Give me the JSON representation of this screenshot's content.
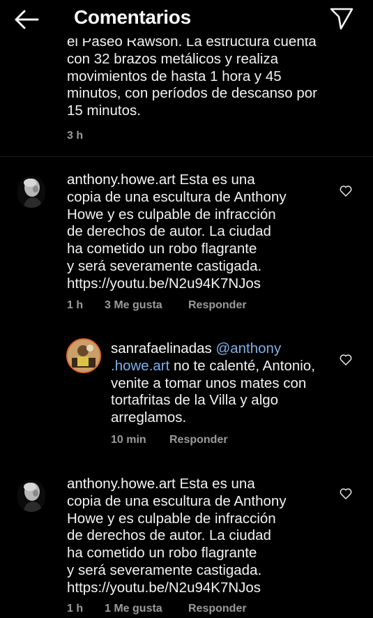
{
  "header": {
    "title": "Comentarios"
  },
  "first_comment": {
    "text_partial": "el Paseo Rawson. La estructura cuenta\ncon 32 brazos metálicos y  realiza\nmovimientos de hasta 1 hora y 45\nminutos, con períodos de descanso por\n15 minutos.",
    "time": "3 h"
  },
  "comments": [
    {
      "username": "anthony.howe.art",
      "text": " Esta es una\ncopia de una escultura de Anthony\nHowe y es culpable de infracción\nde derechos de autor. La ciudad\nha cometido un robo flagrante\ny será severamente castigada.\nhttps://youtu.be/N2u94K7NJos",
      "time": "1 h",
      "likes": "3 Me gusta",
      "reply": "Responder"
    },
    {
      "username": "sanrafaelinadas",
      "mention_part1": " @anthony",
      "mention_part2": ".howe.art",
      "text": " no te calenté, Antonio,\nvenite a tomar unos mates con\ntortafritas de la Villa y algo\narreglamos.",
      "time": "10 min",
      "reply": "Responder"
    },
    {
      "username": "anthony.howe.art",
      "text": " Esta es una\ncopia de una escultura de Anthony\nHowe y es culpable de infracción\nde derechos de autor. La ciudad\nha cometido un robo flagrante\ny será severamente castigada.\nhttps://youtu.be/N2u94K7NJos",
      "time": "1 h",
      "likes": "1 Me gusta",
      "reply": "Responder"
    }
  ]
}
